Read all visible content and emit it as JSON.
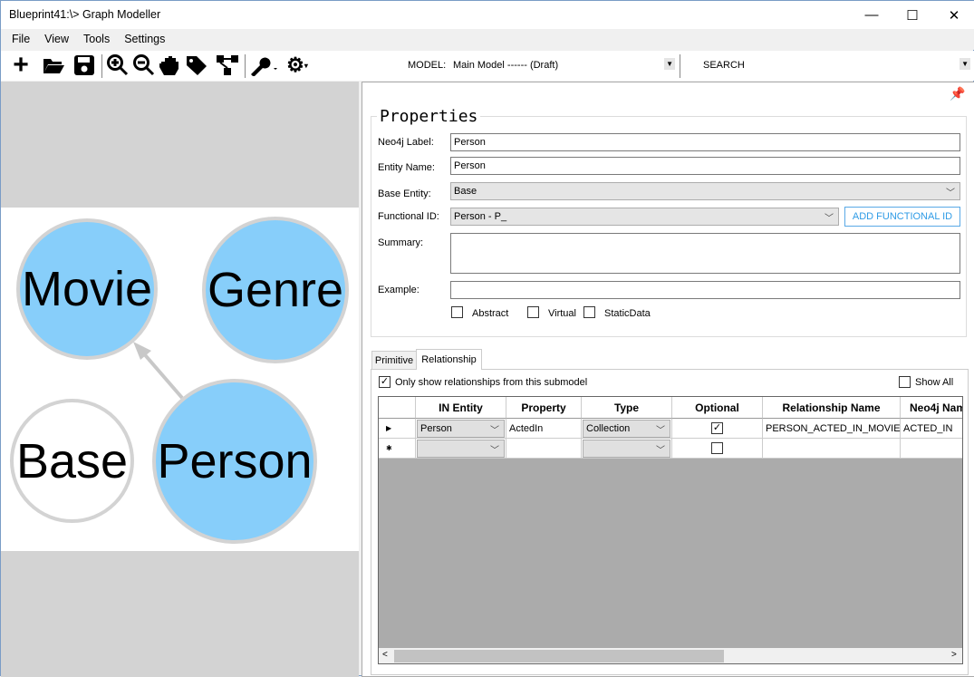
{
  "window": {
    "title": "Blueprint41:\\> Graph Modeller",
    "minimize": "—",
    "maximize": "☐",
    "close": "✕"
  },
  "menu": [
    "File",
    "View",
    "Tools",
    "Settings"
  ],
  "toolbar": {
    "model_label": "MODEL:",
    "model_value": "Main Model ------ (Draft)",
    "search_value": "SEARCH"
  },
  "graph": {
    "nodes": [
      {
        "label": "Movie",
        "fill": "#87cefa"
      },
      {
        "label": "Genre",
        "fill": "#87cefa"
      },
      {
        "label": "Base",
        "fill": "#ffffff"
      },
      {
        "label": "Person",
        "fill": "#87cefa"
      }
    ],
    "edge": {
      "from": "Person",
      "to": "Movie"
    }
  },
  "properties": {
    "title": "Properties",
    "neo4j_label": "Neo4j Label:",
    "neo4j_value": "Person",
    "entity_name_label": "Entity Name:",
    "entity_name_value": "Person",
    "base_entity_label": "Base Entity:",
    "base_entity_value": "Base",
    "functional_id_label": "Functional ID:",
    "functional_id_value": "Person - P_",
    "add_functional_id": "ADD FUNCTIONAL ID",
    "summary_label": "Summary:",
    "summary_value": "",
    "example_label": "Example:",
    "example_value": "",
    "abstract": "Abstract",
    "virtual": "Virtual",
    "static_data": "StaticData",
    "abstract_checked": false,
    "virtual_checked": false,
    "static_checked": false
  },
  "tabs": [
    "Primitive",
    "Relationship"
  ],
  "relationship": {
    "only_submodel": "Only show relationships from this submodel",
    "only_submodel_checked": true,
    "show_all": "Show All",
    "show_all_checked": false,
    "columns": [
      "IN Entity",
      "Property",
      "Type",
      "Optional",
      "Relationship Name",
      "Neo4j Nam"
    ],
    "rows": [
      {
        "in_entity": "Person",
        "property": "ActedIn",
        "type": "Collection",
        "optional": true,
        "relationship_name": "PERSON_ACTED_IN_MOVIE",
        "neo4j_name": "ACTED_IN"
      }
    ],
    "new_row_optional": false
  }
}
